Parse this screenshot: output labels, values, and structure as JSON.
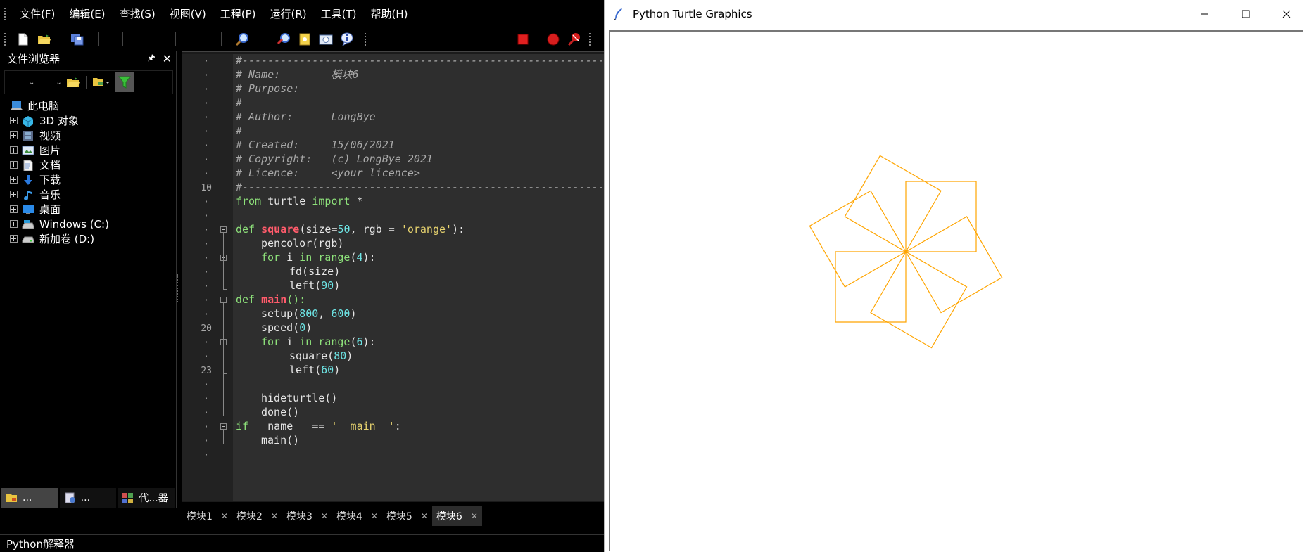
{
  "ide": {
    "menu": [
      "文件(F)",
      "编辑(E)",
      "查找(S)",
      "视图(V)",
      "工程(P)",
      "运行(R)",
      "工具(T)",
      "帮助(H)"
    ],
    "file_browser": {
      "title": "文件浏览器",
      "root": "此电脑",
      "items": [
        {
          "label": "3D 对象",
          "icon": "cube-icon"
        },
        {
          "label": "视频",
          "icon": "film-icon"
        },
        {
          "label": "图片",
          "icon": "picture-icon"
        },
        {
          "label": "文档",
          "icon": "document-icon"
        },
        {
          "label": "下载",
          "icon": "download-arrow-icon"
        },
        {
          "label": "音乐",
          "icon": "music-note-icon"
        },
        {
          "label": "桌面",
          "icon": "desktop-icon"
        },
        {
          "label": "Windows (C:)",
          "icon": "drive-windows-icon"
        },
        {
          "label": "新加卷 (D:)",
          "icon": "drive-icon"
        }
      ],
      "tabs": [
        "...",
        "...",
        "代...器"
      ]
    },
    "gutter_labels": {
      "line10": "10",
      "line20": "20",
      "line23": "23"
    },
    "code": {
      "l1": "#------------------------------------------------------------",
      "l2a": "# Name:        ",
      "l2b": "模块6",
      "l3": "# Purpose:",
      "l4": "#",
      "l5": "# Author:      LongBye",
      "l6": "#",
      "l7": "# Created:     15/06/2021",
      "l8": "# Copyright:   (c) LongBye 2021",
      "l9": "# Licence:     <your licence>",
      "l10": "#------------------------------------------------------------",
      "l11_kw1": "from",
      "l11_mod": " turtle ",
      "l11_kw2": "import",
      "l11_rest": " *",
      "l13_kw": "def",
      "l13_fn": "square",
      "l13_a": "(size=",
      "l13_n": "50",
      "l13_b": ", rgb = ",
      "l13_s": "'orange'",
      "l13_c": "):",
      "l14": "pencolor(rgb)",
      "l15_kw1": "for",
      "l15_a": " i ",
      "l15_kw2": "in",
      "l15_kw3": " range",
      "l15_b": "(",
      "l15_n": "4",
      "l15_c": "):",
      "l16_a": "fd(size)",
      "l17_a": "left(",
      "l17_n": "90",
      "l17_b": ")",
      "l18_kw": "def",
      "l18_fn": "main",
      "l18_a": "():",
      "l19_a": "setup(",
      "l19_n1": "800",
      "l19_b": ", ",
      "l19_n2": "600",
      "l19_c": ")",
      "l20_a": "speed(",
      "l20_n": "0",
      "l20_b": ")",
      "l21_kw1": "for",
      "l21_a": " i ",
      "l21_kw2": "in",
      "l21_kw3": " range",
      "l21_b": "(",
      "l21_n": "6",
      "l21_c": "):",
      "l22_a": "square(",
      "l22_n": "80",
      "l22_b": ")",
      "l23_a": "left(",
      "l23_n": "60",
      "l23_b": ")",
      "l25": "hideturtle()",
      "l26": "done()",
      "l27_kw": "if",
      "l27_a": " __name__ == ",
      "l27_s": "'__main__'",
      "l27_b": ":",
      "l28": "main()"
    },
    "tabs": [
      "模块1",
      "模块2",
      "模块3",
      "模块4",
      "模块5",
      "模块6"
    ],
    "active_tab": "模块6",
    "status": "Python解释器"
  },
  "turtle_window": {
    "title": "Python Turtle Graphics",
    "pen_color": "#ffa500",
    "square_size": 80,
    "rotation_step_deg": 60,
    "square_count": 6
  }
}
